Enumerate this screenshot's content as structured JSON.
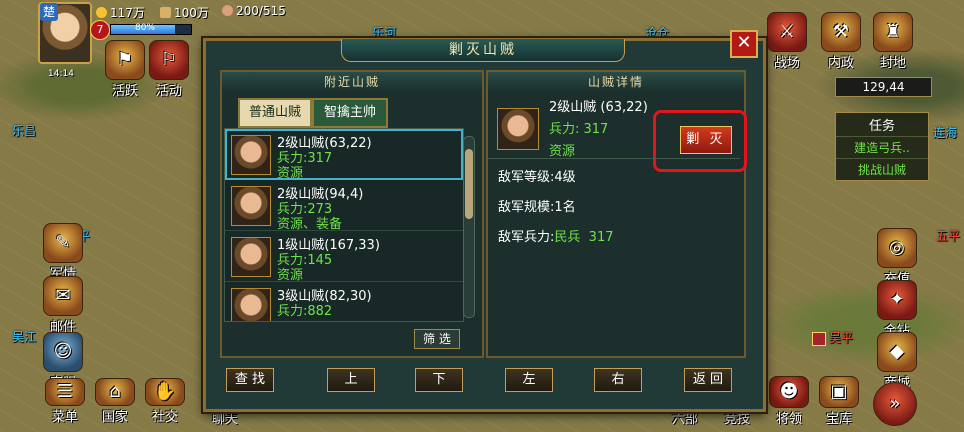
{
  "hud": {
    "kingdom": "楚",
    "vip": "7",
    "gold": "117万",
    "food": "100万",
    "troops": "200/515",
    "exp_percent": "80%",
    "exp_fraction": 0.8,
    "clock": "14:14",
    "coords": "129,44"
  },
  "left_buttons": [
    {
      "label": "活跃"
    },
    {
      "label": "活动"
    },
    {
      "label": "军情"
    },
    {
      "label": "邮件"
    },
    {
      "label": "客服"
    }
  ],
  "bottom_buttons": [
    {
      "label": "菜单"
    },
    {
      "label": "国家"
    },
    {
      "label": "社交"
    },
    {
      "label": "聊天"
    }
  ],
  "right_top_buttons": [
    {
      "label": "战场"
    },
    {
      "label": "内政"
    },
    {
      "label": "封地"
    }
  ],
  "right_buttons": [
    {
      "label": "充值"
    },
    {
      "label": "金钻"
    },
    {
      "label": "商城"
    }
  ],
  "bottom_right_buttons": [
    {
      "label": "六部"
    },
    {
      "label": "竞技"
    },
    {
      "label": "将领"
    },
    {
      "label": "宝库"
    }
  ],
  "task": {
    "title": "任务",
    "items": [
      "建造弓兵..",
      "挑战山贼"
    ]
  },
  "map_labels": {
    "lechang": "乐昌",
    "wujiang": "吴江",
    "wuping": "吴平",
    "wuping2": "五平",
    "lianhe": "连海",
    "lehe": "乐河",
    "cang": "沧仓",
    "ping": "平"
  },
  "dialog": {
    "title": "剿灭山贼",
    "left_header": "附近山贼",
    "right_header": "山贼详情",
    "tabs": [
      "普通山贼",
      "智擒主帅"
    ],
    "bandits": [
      {
        "name": "2级山贼(63,22)",
        "strength": "兵力:317",
        "resources": "资源"
      },
      {
        "name": "2级山贼(94,4)",
        "strength": "兵力:273",
        "resources": "资源、装备"
      },
      {
        "name": "1级山贼(167,33)",
        "strength": "兵力:145",
        "resources": "资源"
      },
      {
        "name": "3级山贼(82,30)",
        "strength": "兵力:882",
        "resources": ""
      }
    ],
    "filter": "筛 选",
    "detail": {
      "name": "2级山贼  (63,22)",
      "strength": "兵力: 317",
      "resources": "资源",
      "wipe_button": "剿 灭",
      "enemy_level": "敌军等级:4级",
      "enemy_scale": "敌军规模:1名",
      "enemy_strength_label": "敌军兵力:",
      "enemy_strength_type": "民兵",
      "enemy_strength_value": "317"
    },
    "nav": [
      "查 找",
      "上",
      "下",
      "左",
      "右",
      "返 回"
    ]
  },
  "colors": {
    "highlight": "#e0161c",
    "green_text": "#6ee34a",
    "panel_bg": "#1c2f2c"
  }
}
